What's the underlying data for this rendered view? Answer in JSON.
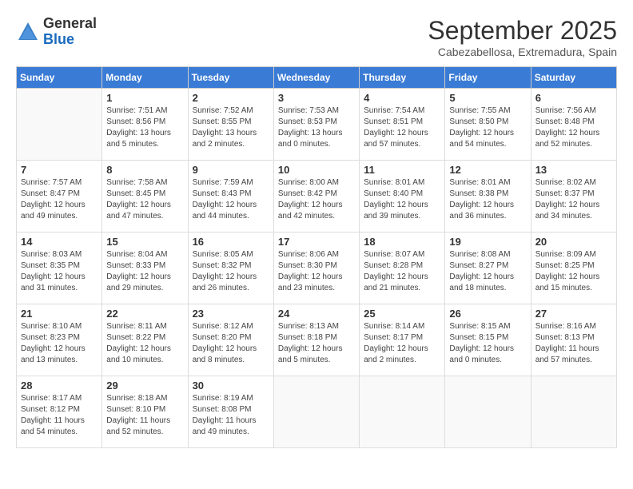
{
  "logo": {
    "general": "General",
    "blue": "Blue"
  },
  "header": {
    "month": "September 2025",
    "location": "Cabezabellosa, Extremadura, Spain"
  },
  "weekdays": [
    "Sunday",
    "Monday",
    "Tuesday",
    "Wednesday",
    "Thursday",
    "Friday",
    "Saturday"
  ],
  "weeks": [
    [
      {
        "day": "",
        "sunrise": "",
        "sunset": "",
        "daylight": ""
      },
      {
        "day": "1",
        "sunrise": "Sunrise: 7:51 AM",
        "sunset": "Sunset: 8:56 PM",
        "daylight": "Daylight: 13 hours and 5 minutes."
      },
      {
        "day": "2",
        "sunrise": "Sunrise: 7:52 AM",
        "sunset": "Sunset: 8:55 PM",
        "daylight": "Daylight: 13 hours and 2 minutes."
      },
      {
        "day": "3",
        "sunrise": "Sunrise: 7:53 AM",
        "sunset": "Sunset: 8:53 PM",
        "daylight": "Daylight: 13 hours and 0 minutes."
      },
      {
        "day": "4",
        "sunrise": "Sunrise: 7:54 AM",
        "sunset": "Sunset: 8:51 PM",
        "daylight": "Daylight: 12 hours and 57 minutes."
      },
      {
        "day": "5",
        "sunrise": "Sunrise: 7:55 AM",
        "sunset": "Sunset: 8:50 PM",
        "daylight": "Daylight: 12 hours and 54 minutes."
      },
      {
        "day": "6",
        "sunrise": "Sunrise: 7:56 AM",
        "sunset": "Sunset: 8:48 PM",
        "daylight": "Daylight: 12 hours and 52 minutes."
      }
    ],
    [
      {
        "day": "7",
        "sunrise": "Sunrise: 7:57 AM",
        "sunset": "Sunset: 8:47 PM",
        "daylight": "Daylight: 12 hours and 49 minutes."
      },
      {
        "day": "8",
        "sunrise": "Sunrise: 7:58 AM",
        "sunset": "Sunset: 8:45 PM",
        "daylight": "Daylight: 12 hours and 47 minutes."
      },
      {
        "day": "9",
        "sunrise": "Sunrise: 7:59 AM",
        "sunset": "Sunset: 8:43 PM",
        "daylight": "Daylight: 12 hours and 44 minutes."
      },
      {
        "day": "10",
        "sunrise": "Sunrise: 8:00 AM",
        "sunset": "Sunset: 8:42 PM",
        "daylight": "Daylight: 12 hours and 42 minutes."
      },
      {
        "day": "11",
        "sunrise": "Sunrise: 8:01 AM",
        "sunset": "Sunset: 8:40 PM",
        "daylight": "Daylight: 12 hours and 39 minutes."
      },
      {
        "day": "12",
        "sunrise": "Sunrise: 8:01 AM",
        "sunset": "Sunset: 8:38 PM",
        "daylight": "Daylight: 12 hours and 36 minutes."
      },
      {
        "day": "13",
        "sunrise": "Sunrise: 8:02 AM",
        "sunset": "Sunset: 8:37 PM",
        "daylight": "Daylight: 12 hours and 34 minutes."
      }
    ],
    [
      {
        "day": "14",
        "sunrise": "Sunrise: 8:03 AM",
        "sunset": "Sunset: 8:35 PM",
        "daylight": "Daylight: 12 hours and 31 minutes."
      },
      {
        "day": "15",
        "sunrise": "Sunrise: 8:04 AM",
        "sunset": "Sunset: 8:33 PM",
        "daylight": "Daylight: 12 hours and 29 minutes."
      },
      {
        "day": "16",
        "sunrise": "Sunrise: 8:05 AM",
        "sunset": "Sunset: 8:32 PM",
        "daylight": "Daylight: 12 hours and 26 minutes."
      },
      {
        "day": "17",
        "sunrise": "Sunrise: 8:06 AM",
        "sunset": "Sunset: 8:30 PM",
        "daylight": "Daylight: 12 hours and 23 minutes."
      },
      {
        "day": "18",
        "sunrise": "Sunrise: 8:07 AM",
        "sunset": "Sunset: 8:28 PM",
        "daylight": "Daylight: 12 hours and 21 minutes."
      },
      {
        "day": "19",
        "sunrise": "Sunrise: 8:08 AM",
        "sunset": "Sunset: 8:27 PM",
        "daylight": "Daylight: 12 hours and 18 minutes."
      },
      {
        "day": "20",
        "sunrise": "Sunrise: 8:09 AM",
        "sunset": "Sunset: 8:25 PM",
        "daylight": "Daylight: 12 hours and 15 minutes."
      }
    ],
    [
      {
        "day": "21",
        "sunrise": "Sunrise: 8:10 AM",
        "sunset": "Sunset: 8:23 PM",
        "daylight": "Daylight: 12 hours and 13 minutes."
      },
      {
        "day": "22",
        "sunrise": "Sunrise: 8:11 AM",
        "sunset": "Sunset: 8:22 PM",
        "daylight": "Daylight: 12 hours and 10 minutes."
      },
      {
        "day": "23",
        "sunrise": "Sunrise: 8:12 AM",
        "sunset": "Sunset: 8:20 PM",
        "daylight": "Daylight: 12 hours and 8 minutes."
      },
      {
        "day": "24",
        "sunrise": "Sunrise: 8:13 AM",
        "sunset": "Sunset: 8:18 PM",
        "daylight": "Daylight: 12 hours and 5 minutes."
      },
      {
        "day": "25",
        "sunrise": "Sunrise: 8:14 AM",
        "sunset": "Sunset: 8:17 PM",
        "daylight": "Daylight: 12 hours and 2 minutes."
      },
      {
        "day": "26",
        "sunrise": "Sunrise: 8:15 AM",
        "sunset": "Sunset: 8:15 PM",
        "daylight": "Daylight: 12 hours and 0 minutes."
      },
      {
        "day": "27",
        "sunrise": "Sunrise: 8:16 AM",
        "sunset": "Sunset: 8:13 PM",
        "daylight": "Daylight: 11 hours and 57 minutes."
      }
    ],
    [
      {
        "day": "28",
        "sunrise": "Sunrise: 8:17 AM",
        "sunset": "Sunset: 8:12 PM",
        "daylight": "Daylight: 11 hours and 54 minutes."
      },
      {
        "day": "29",
        "sunrise": "Sunrise: 8:18 AM",
        "sunset": "Sunset: 8:10 PM",
        "daylight": "Daylight: 11 hours and 52 minutes."
      },
      {
        "day": "30",
        "sunrise": "Sunrise: 8:19 AM",
        "sunset": "Sunset: 8:08 PM",
        "daylight": "Daylight: 11 hours and 49 minutes."
      },
      {
        "day": "",
        "sunrise": "",
        "sunset": "",
        "daylight": ""
      },
      {
        "day": "",
        "sunrise": "",
        "sunset": "",
        "daylight": ""
      },
      {
        "day": "",
        "sunrise": "",
        "sunset": "",
        "daylight": ""
      },
      {
        "day": "",
        "sunrise": "",
        "sunset": "",
        "daylight": ""
      }
    ]
  ]
}
